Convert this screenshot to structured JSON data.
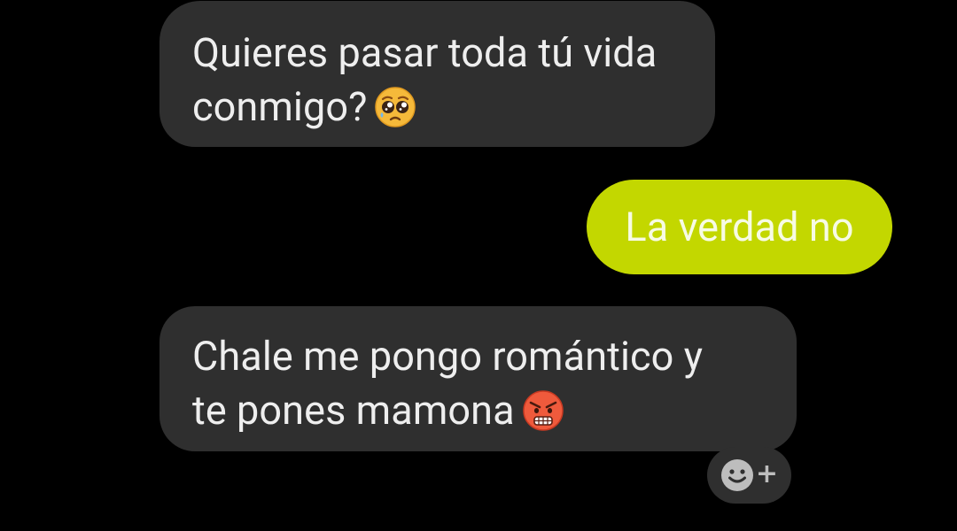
{
  "messages": [
    {
      "direction": "received",
      "lines": [
        "Quieres pasar toda tú vida",
        "conmigo?"
      ],
      "emoji": "pleading-face-emoji"
    },
    {
      "direction": "sent",
      "lines": [
        "La verdad no"
      ]
    },
    {
      "direction": "received",
      "lines": [
        "Chale me pongo romántico y",
        "te pones mamona"
      ],
      "emoji": "enraged-face-emoji"
    }
  ],
  "reaction_button": {
    "icon": "add-reaction-icon",
    "symbol": "+"
  },
  "colors": {
    "background": "#000000",
    "received_bubble": "#2f2f2f",
    "received_text": "#eeeeee",
    "sent_bubble": "#c3d700",
    "sent_text": "#f7fbe4"
  }
}
